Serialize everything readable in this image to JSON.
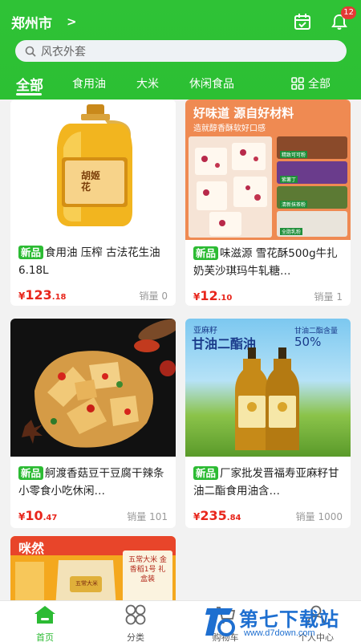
{
  "header": {
    "city": "郑州市",
    "city_arrow": ">",
    "notification_count": "12"
  },
  "search": {
    "placeholder": "风衣外套"
  },
  "tabs": [
    {
      "label": "全部",
      "active": true
    },
    {
      "label": "食用油"
    },
    {
      "label": "大米"
    },
    {
      "label": "休闲食品"
    }
  ],
  "tab_all_label": "全部",
  "products": [
    {
      "tag": "新品",
      "title": "食用油 压榨 古法花生油6.18L",
      "price_yen": "¥",
      "price_int": "123",
      "price_dec": ".18",
      "sales": "销量 0"
    },
    {
      "tag": "新品",
      "title": "味滋源 雪花酥500g牛扎奶芙沙琪玛牛轧糖…",
      "price_yen": "¥",
      "price_int": "12",
      "price_dec": ".10",
      "sales": "销量 1",
      "banner_line1": "好味道 源自好材料",
      "banner_line2": "造就醇香酥软好口感",
      "labels": [
        "精致可可粉",
        "紫薯丁",
        "清新抹茶粉",
        "全脂乳粉"
      ]
    },
    {
      "tag": "新品",
      "title": "舸渡香菇豆干豆腐干辣条小零食小吃休闲…",
      "price_yen": "¥",
      "price_int": "10",
      "price_dec": ".47",
      "sales": "销量 101"
    },
    {
      "tag": "新品",
      "title": "厂家批发晋福寿亚麻籽甘油二酯食用油含…",
      "price_yen": "¥",
      "price_int": "235",
      "price_dec": ".84",
      "sales": "销量 1000",
      "banner_small": "亚麻籽",
      "banner_big": "甘油二酯油",
      "banner_right": "甘油二酯含量",
      "banner_pct": "50%"
    },
    {
      "banner_tag": "咪然",
      "box_text": "五常大米 金香稻1号 礼盒装",
      "bag_label": "五常大米"
    }
  ],
  "product_1_bottle_label": "胡姬花",
  "nav": [
    {
      "label": "首页",
      "icon": "home-icon",
      "active": true
    },
    {
      "label": "分类",
      "icon": "category-icon"
    },
    {
      "label": "购物车",
      "icon": "cart-icon"
    },
    {
      "label": "个人中心",
      "icon": "user-icon"
    }
  ],
  "watermark": {
    "brand": "第七下载站",
    "url": "www.d7down.com"
  },
  "colors": {
    "brand_green": "#2cc033",
    "price_red": "#e8261c",
    "badge_red": "#e53935"
  }
}
